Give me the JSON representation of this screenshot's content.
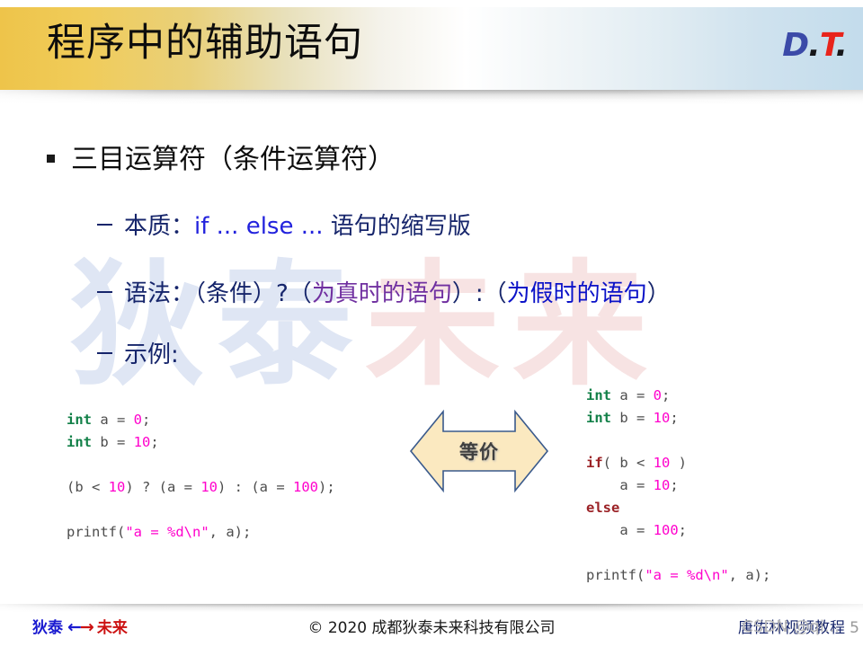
{
  "header": {
    "title": "程序中的辅助语句",
    "logo": {
      "part_d": "D",
      "dot1": ".",
      "part_t": "T",
      "dot2": "."
    }
  },
  "watermark": {
    "background_blue": "狄泰",
    "background_red": "未来",
    "csdn": "CSDN @qi..."
  },
  "content": {
    "bullet1": "三目运算符（条件运算符）",
    "bullet2_1": {
      "prefix": "本质：",
      "highlight": "if ... else ...",
      "suffix": " 语句的缩写版"
    },
    "bullet2_2": {
      "prefix": "语法：（条件）?（",
      "true_branch": "为真时的语句",
      "middle": "）:（",
      "false_branch": "为假时的语句",
      "suffix": "）"
    },
    "bullet2_3": "示例:"
  },
  "code_left": {
    "lines": [
      [
        {
          "t": "int",
          "c": "kw-int"
        },
        {
          "t": " a = ",
          "c": "plain"
        },
        {
          "t": "0",
          "c": "num"
        },
        {
          "t": ";",
          "c": "plain"
        }
      ],
      [
        {
          "t": "int",
          "c": "kw-int"
        },
        {
          "t": " b = ",
          "c": "plain"
        },
        {
          "t": "10",
          "c": "num"
        },
        {
          "t": ";",
          "c": "plain"
        }
      ],
      [],
      [
        {
          "t": "(b < ",
          "c": "plain"
        },
        {
          "t": "10",
          "c": "num"
        },
        {
          "t": ") ? (a = ",
          "c": "plain"
        },
        {
          "t": "10",
          "c": "num"
        },
        {
          "t": ") : (a = ",
          "c": "plain"
        },
        {
          "t": "100",
          "c": "num"
        },
        {
          "t": ");",
          "c": "plain"
        }
      ],
      [],
      [
        {
          "t": "printf(",
          "c": "plain"
        },
        {
          "t": "\"a = %d\\n\"",
          "c": "str"
        },
        {
          "t": ", a);",
          "c": "plain"
        }
      ]
    ]
  },
  "code_right": {
    "lines": [
      [
        {
          "t": "int",
          "c": "kw-int"
        },
        {
          "t": " a = ",
          "c": "plain"
        },
        {
          "t": "0",
          "c": "num"
        },
        {
          "t": ";",
          "c": "plain"
        }
      ],
      [
        {
          "t": "int",
          "c": "kw-int"
        },
        {
          "t": " b = ",
          "c": "plain"
        },
        {
          "t": "10",
          "c": "num"
        },
        {
          "t": ";",
          "c": "plain"
        }
      ],
      [],
      [
        {
          "t": "if",
          "c": "kw-ctl"
        },
        {
          "t": "( b < ",
          "c": "plain"
        },
        {
          "t": "10",
          "c": "num"
        },
        {
          "t": " )",
          "c": "plain"
        }
      ],
      [
        {
          "t": "    a = ",
          "c": "plain"
        },
        {
          "t": "10",
          "c": "num"
        },
        {
          "t": ";",
          "c": "plain"
        }
      ],
      [
        {
          "t": "else",
          "c": "kw-ctl"
        }
      ],
      [
        {
          "t": "    a = ",
          "c": "plain"
        },
        {
          "t": "100",
          "c": "num"
        },
        {
          "t": ";",
          "c": "plain"
        }
      ],
      [],
      [
        {
          "t": "printf(",
          "c": "plain"
        },
        {
          "t": "\"a = %d\\n\"",
          "c": "str"
        },
        {
          "t": ", a);",
          "c": "plain"
        }
      ]
    ]
  },
  "equivalence": {
    "label": "等价",
    "fill_color": "#fbe9c0",
    "border_color": "#3a5a8c"
  },
  "footer": {
    "brand_left": "狄泰",
    "arrows": "←→",
    "brand_right": "未来",
    "copyright": "© 2020 成都狄泰未来科技有限公司",
    "course": "唐佐林视频教程",
    "page_number": "5"
  },
  "colors": {
    "header_gradient_start": "#eec44a",
    "header_gradient_end": "#c3dcec",
    "navy": "#16256b",
    "keyword_blue": "#2222dd",
    "purple": "#7030a0",
    "code_green": "#128048",
    "code_magenta": "#ff00cc",
    "code_red": "#9b2226",
    "logo_blue": "#3b4aa8",
    "logo_red": "#e8241c"
  }
}
